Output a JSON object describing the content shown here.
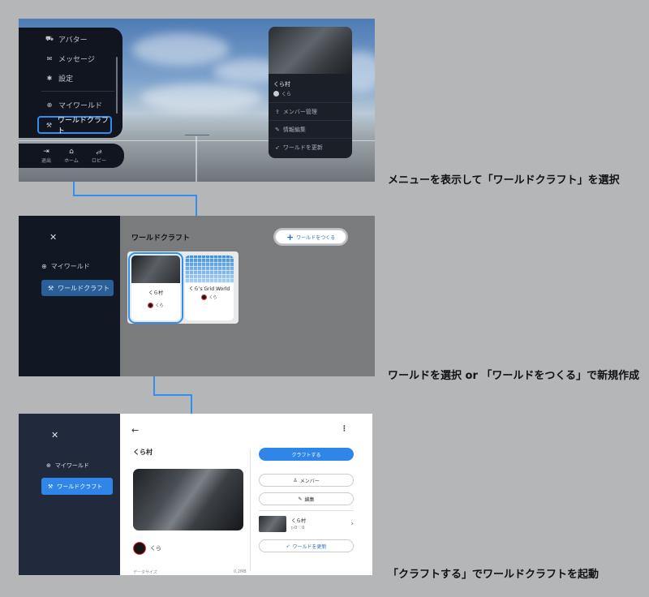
{
  "step1": {
    "menu_items": [
      {
        "icon": "avatar-icon",
        "label": "アバター"
      },
      {
        "icon": "mail-icon",
        "label": "メッセージ"
      },
      {
        "icon": "gear-icon",
        "label": "設定"
      },
      {
        "icon": "globe-icon",
        "label": "マイワールド"
      },
      {
        "icon": "hammer-icon",
        "label": "ワールドクラフト"
      }
    ],
    "bottom_bar": [
      {
        "icon": "exit-icon",
        "label": "退出"
      },
      {
        "icon": "home-icon",
        "label": "ホーム"
      },
      {
        "icon": "lobby-icon",
        "label": "ロビー"
      }
    ],
    "world_card": {
      "name": "くら村",
      "owner": "くら",
      "actions": [
        "メンバー管理",
        "情報編集",
        "ワールドを更新"
      ]
    },
    "caption": "メニューを表示して「ワールドクラフト」を選択"
  },
  "step2": {
    "sidebar": {
      "close": "✕",
      "items": [
        "マイワールド",
        "ワールドクラフト"
      ]
    },
    "title": "ワールドクラフト",
    "create_button": "ワールドをつくる",
    "worlds": [
      {
        "name": "くら村",
        "owner": "くら"
      },
      {
        "name": "くら's Grid World",
        "owner": "くら"
      }
    ],
    "caption": "ワールドを選択 or 「ワールドをつくる」で新規作成"
  },
  "step3": {
    "sidebar": {
      "close": "✕",
      "items": [
        "マイワールド",
        "ワールドクラフト"
      ]
    },
    "world_name": "くら村",
    "owner": "くら",
    "data_size_label": "データサイズ",
    "data_size_value": "0.2MB",
    "buttons": {
      "craft": "クラフトする",
      "members": "メンバー",
      "edit": "編集",
      "update": "ワールドを更新"
    },
    "instance": {
      "name": "くら村",
      "stats": "▷0  ♡0"
    },
    "caption": "「クラフトする」でワールドクラフトを起動"
  },
  "colors": {
    "accent": "#2e8ff0",
    "sidebar_dark": "#121823",
    "sidebar_navy": "#202a3c"
  }
}
